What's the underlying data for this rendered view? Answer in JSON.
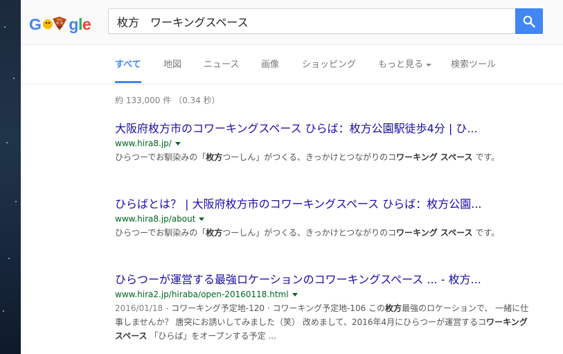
{
  "logo": {
    "letters": [
      "G",
      "g",
      "l",
      "e"
    ]
  },
  "search": {
    "query": "枚方　ワーキングスペース"
  },
  "tabs": [
    "すべて",
    "地図",
    "ニュース",
    "画像",
    "ショッピング",
    "もっと見る",
    "検索ツール"
  ],
  "stats": "約 133,000 件 （0.34 秒）",
  "results": [
    {
      "title": "大阪府枚方市のコワーキングスペース ひらば：枚方公園駅徒歩4分 | ひ...",
      "url": "www.hira8.jp/",
      "snippet": [
        {
          "t": "ひらつーでお馴染みの「",
          "b": false
        },
        {
          "t": "枚方",
          "b": true
        },
        {
          "t": "つーしん」がつくる、きっかけとつながりのコ",
          "b": false
        },
        {
          "t": "ワーキング スペース",
          "b": true
        },
        {
          "t": " です。",
          "b": false
        }
      ]
    },
    {
      "title": "ひらばとは？ | 大阪府枚方市のコワーキングスペース ひらば：枚方公園...",
      "url": "www.hira8.jp/about",
      "snippet": [
        {
          "t": "ひらつーでお馴染みの「",
          "b": false
        },
        {
          "t": "枚方",
          "b": true
        },
        {
          "t": "つーしん」がつくる、きっかけとつながりのコ",
          "b": false
        },
        {
          "t": "ワーキング スペース",
          "b": true
        },
        {
          "t": " です。",
          "b": false
        }
      ]
    },
    {
      "title": "ひらつーが運営する最強ロケーションのコワーキングスペース ... - 枚方...",
      "url": "www.hira2.jp/hiraba/open-20160118.html",
      "date": "2016/01/18 - ",
      "snippet": [
        {
          "t": "コワーキング予定地-120 · コワーキング予定地-106 この",
          "b": false
        },
        {
          "t": "枚方",
          "b": true
        },
        {
          "t": "最強のロケーションで、 一緒に仕事しませんか？ 唐突にお誘いしてみました（笑） 改めまして、2016年4月にひらつーが運営するコ",
          "b": false
        },
        {
          "t": "ワーキングスペース",
          "b": true
        },
        {
          "t": " 「ひらば」をオープンする予定 ...",
          "b": false
        }
      ]
    }
  ],
  "colors": {
    "accent": "#4285f4",
    "link": "#1a0dab",
    "url": "#006621",
    "snippet": "#545454",
    "logo_blue": "#4285f4",
    "logo_green": "#34a853",
    "logo_yellow": "#fbbc05",
    "logo_red": "#ea4335"
  },
  "icons": {
    "search_button": "magnifier-icon",
    "doodle": "doodle-character-icon"
  }
}
